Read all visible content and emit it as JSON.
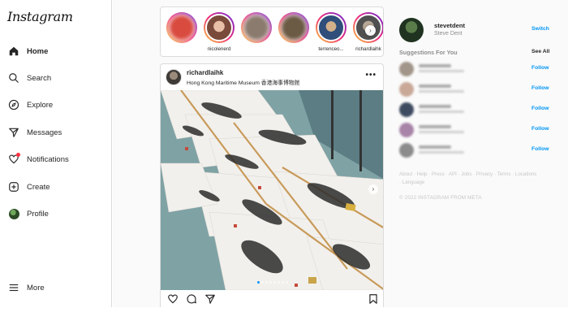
{
  "app": {
    "logo": "Instagram"
  },
  "nav": [
    {
      "label": "Home",
      "icon": "home-icon",
      "active": true
    },
    {
      "label": "Search",
      "icon": "search-icon"
    },
    {
      "label": "Explore",
      "icon": "compass-icon"
    },
    {
      "label": "Messages",
      "icon": "paper-plane-icon"
    },
    {
      "label": "Notifications",
      "icon": "heart-icon"
    },
    {
      "label": "Create",
      "icon": "plus-square-icon"
    },
    {
      "label": "Profile",
      "icon": "avatar-icon"
    },
    {
      "label": "More",
      "icon": "hamburger-icon"
    }
  ],
  "stories": [
    {
      "username": "",
      "blurred": true,
      "color": "#d94b3f"
    },
    {
      "username": "nicolenerd",
      "blurred": false,
      "color": "#c89880"
    },
    {
      "username": "",
      "blurred": true,
      "color": "#8a7b6e"
    },
    {
      "username": "",
      "blurred": true,
      "color": "#6b5b45"
    },
    {
      "username": "terrenceo...",
      "blurred": false,
      "color": "#3b5b8a"
    },
    {
      "username": "richardlaihk",
      "blurred": false,
      "color": "#a0a0a0"
    }
  ],
  "post": {
    "username": "richardlaihk",
    "location": "Hong Kong Maritime Museum 香港海事博物館",
    "more_label": "•••"
  },
  "profile": {
    "username": "stevetdent",
    "name": "Steve Dent",
    "switch_label": "Switch"
  },
  "suggestions": {
    "title": "Suggestions For You",
    "see_all_label": "See All",
    "follow_label": "Follow",
    "count": 5
  },
  "footer": {
    "links": "About · Help · Press · API · Jobs · Privacy · Terms · Locations · Language",
    "copyright": "© 2022 INSTAGRAM FROM META"
  },
  "colors": {
    "accent": "#0095f6",
    "border": "#dbdbdb",
    "muted": "#8e8e8e"
  }
}
